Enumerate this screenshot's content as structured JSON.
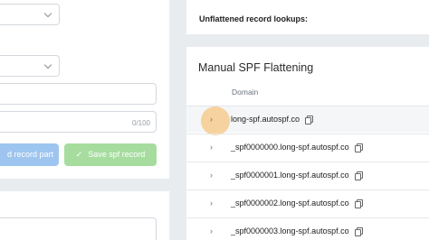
{
  "left_form": {
    "counter": "0/100",
    "add_button": "d record part",
    "save_button": "Save spf record",
    "save_icon": "check-icon"
  },
  "right_top": {
    "label": "Unflattened record lookups:"
  },
  "manual": {
    "title": "Manual SPF Flattening",
    "column_header": "Domain",
    "rows": [
      {
        "domain": "long-spf.autospf.co"
      },
      {
        "domain": "_spf0000000.long-spf.autospf.co"
      },
      {
        "domain": "_spf0000001.long-spf.autospf.co"
      },
      {
        "domain": "_spf0000002.long-spf.autospf.co"
      },
      {
        "domain": "_spf0000003.long-spf.autospf.co"
      }
    ]
  },
  "icons": {
    "expand": "chevron-right-icon",
    "copy": "copy-icon"
  },
  "colors": {
    "save_button": "#a6dd9f",
    "add_button": "#9ec5ef",
    "cursor_highlight": "#f6be6e"
  }
}
